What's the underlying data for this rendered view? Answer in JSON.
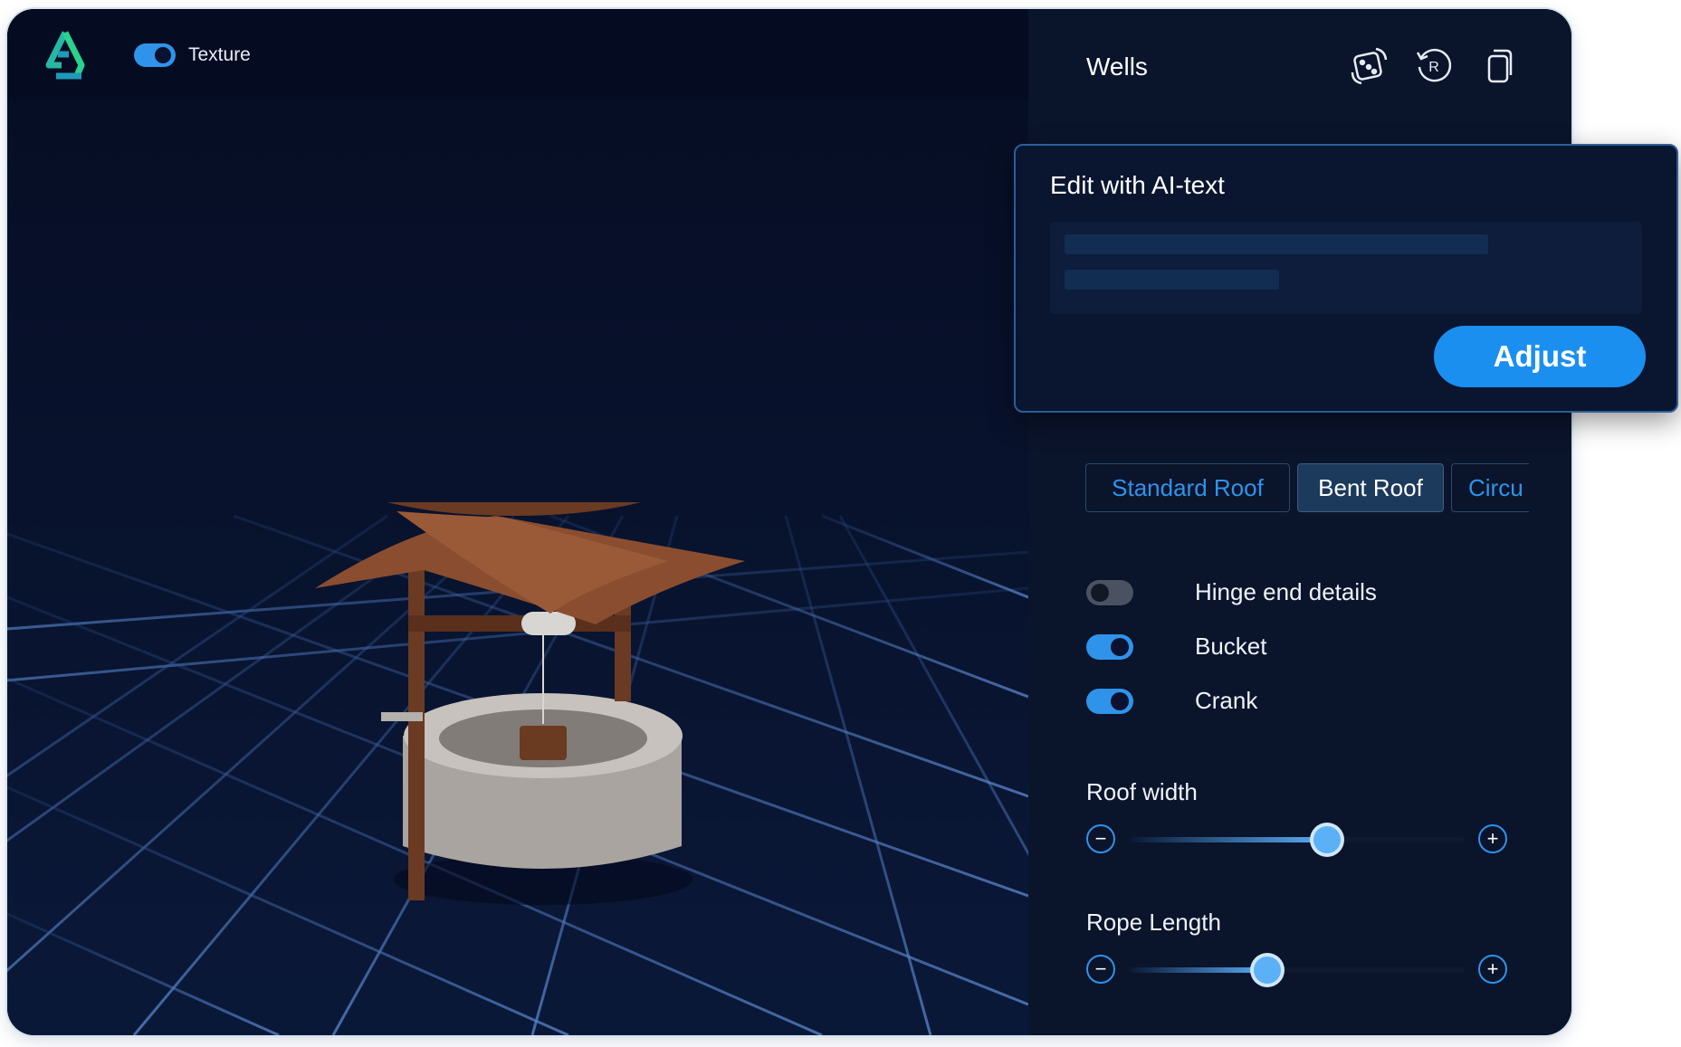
{
  "viewport": {
    "logo_icon": "app-logo",
    "texture_toggle": {
      "label": "Texture",
      "on": true
    }
  },
  "panel": {
    "title": "Wells",
    "tools": [
      {
        "icon": "randomize-dice-icon"
      },
      {
        "icon": "reset-icon"
      },
      {
        "icon": "copy-icon"
      }
    ],
    "roof_tabs": [
      {
        "label": "Standard Roof",
        "active": false
      },
      {
        "label": "Bent Roof",
        "active": true
      },
      {
        "label": "Circu",
        "active": false
      }
    ],
    "options": [
      {
        "label": "Hinge end details",
        "on": false
      },
      {
        "label": "Bucket",
        "on": true
      },
      {
        "label": "Crank",
        "on": true
      }
    ],
    "sliders": [
      {
        "label": "Roof width",
        "value": 0.59,
        "minus": "−",
        "plus": "+"
      },
      {
        "label": "Rope Length",
        "value": 0.41,
        "minus": "−",
        "plus": "+"
      }
    ]
  },
  "ai_edit": {
    "title": "Edit with AI-text",
    "button_label": "Adjust"
  },
  "colors": {
    "accent": "#2f93ea",
    "background": "#070f26",
    "panel": "#0a142b"
  }
}
